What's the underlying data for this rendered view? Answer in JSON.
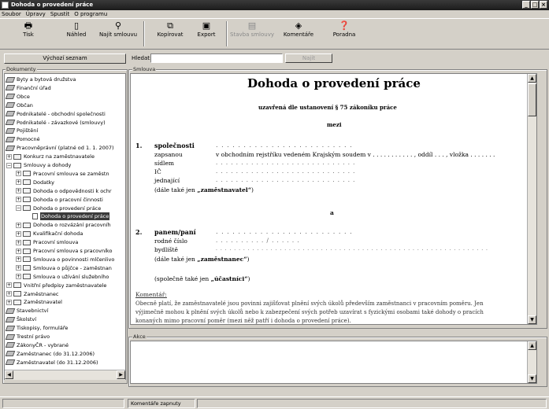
{
  "window": {
    "title": "Dohoda o provedení práce"
  },
  "menu": [
    "Soubor",
    "Úpravy",
    "Spustit",
    "O programu"
  ],
  "toolbar": [
    {
      "label": "Tisk",
      "icon": "printer-icon",
      "glyph": "🖶",
      "enabled": true
    },
    {
      "label": "Náhled",
      "icon": "page-preview-icon",
      "glyph": "▯",
      "enabled": true
    },
    {
      "label": "Najít smlouvu",
      "icon": "binoculars-icon",
      "glyph": "⚲",
      "enabled": true
    },
    {
      "label": "Kopírovat",
      "icon": "copy-icon",
      "glyph": "⧉",
      "enabled": true
    },
    {
      "label": "Export",
      "icon": "floppy-disk-icon",
      "glyph": "▣",
      "enabled": true
    },
    {
      "label": "Stavba smlouvy",
      "icon": "structure-icon",
      "glyph": "▤",
      "enabled": false
    },
    {
      "label": "Komentáře",
      "icon": "comment-icon",
      "glyph": "◈",
      "enabled": true
    },
    {
      "label": "Poradna",
      "icon": "help-icon",
      "glyph": "❓",
      "enabled": true
    }
  ],
  "left": {
    "home_button": "Výchozí seznam",
    "group_label": "Dokumenty"
  },
  "search": {
    "label": "Hledat:",
    "value": "",
    "button": "Najít"
  },
  "doc_group_label": "Smlouva",
  "akce_group_label": "Akce",
  "tree": [
    {
      "label": "Byty a bytová družstva",
      "level": 0,
      "icon": "book",
      "expander": ""
    },
    {
      "label": "Finanční úřad",
      "level": 0,
      "icon": "book",
      "expander": ""
    },
    {
      "label": "Obce",
      "level": 0,
      "icon": "book",
      "expander": ""
    },
    {
      "label": "Občan",
      "level": 0,
      "icon": "book",
      "expander": ""
    },
    {
      "label": "Podnikatelé - obchodní společnosti",
      "level": 0,
      "icon": "book",
      "expander": ""
    },
    {
      "label": "Podnikatelé - závazkové (smlouvy)",
      "level": 0,
      "icon": "book",
      "expander": ""
    },
    {
      "label": "Pojištění",
      "level": 0,
      "icon": "book",
      "expander": ""
    },
    {
      "label": "Pomocné",
      "level": 0,
      "icon": "book",
      "expander": ""
    },
    {
      "label": "Pracovněprávní (platné od 1. 1. 2007)",
      "level": 0,
      "icon": "book",
      "expander": ""
    },
    {
      "label": "Konkurz na zaměstnavatele",
      "level": 1,
      "icon": "folder",
      "expander": "+"
    },
    {
      "label": "Smlouvy a dohody",
      "level": 1,
      "icon": "folder",
      "expander": "−"
    },
    {
      "label": "Pracovní smlouva se zaměstn",
      "level": 2,
      "icon": "folder",
      "expander": "+"
    },
    {
      "label": "Dodatky",
      "level": 2,
      "icon": "folder",
      "expander": "+"
    },
    {
      "label": "Dohoda o odpovědnosti k ochr",
      "level": 2,
      "icon": "folder",
      "expander": "+"
    },
    {
      "label": "Dohoda o pracovní činnosti",
      "level": 2,
      "icon": "folder",
      "expander": "+"
    },
    {
      "label": "Dohoda o provedení práce",
      "level": 2,
      "icon": "folder",
      "expander": "−"
    },
    {
      "label": "Dohoda o provedení práce",
      "level": 3,
      "icon": "doc",
      "expander": "",
      "selected": true
    },
    {
      "label": "Dohoda o rozvázání pracovníh",
      "level": 2,
      "icon": "folder",
      "expander": "+"
    },
    {
      "label": "Kvalifikační dohoda",
      "level": 2,
      "icon": "folder",
      "expander": "+"
    },
    {
      "label": "Pracovní smlouva",
      "level": 2,
      "icon": "folder",
      "expander": "+"
    },
    {
      "label": "Pracovní smlouva s pracovníko",
      "level": 2,
      "icon": "folder",
      "expander": "+"
    },
    {
      "label": "Smlouva o povinnosti mlčenlivo",
      "level": 2,
      "icon": "folder",
      "expander": "+"
    },
    {
      "label": "Smlouva o půjčce - zaměstnan",
      "level": 2,
      "icon": "folder",
      "expander": "+"
    },
    {
      "label": "Smlouva o užívání služebního",
      "level": 2,
      "icon": "folder",
      "expander": "+"
    },
    {
      "label": "Vnitřní předpisy zaměstnavatele",
      "level": 1,
      "icon": "folder",
      "expander": "+"
    },
    {
      "label": "Zaměstnanec",
      "level": 1,
      "icon": "folder",
      "expander": "+"
    },
    {
      "label": "Zaměstnavatel",
      "level": 1,
      "icon": "folder",
      "expander": "+"
    },
    {
      "label": "Stavebnictví",
      "level": 0,
      "icon": "book",
      "expander": ""
    },
    {
      "label": "Školství",
      "level": 0,
      "icon": "book",
      "expander": ""
    },
    {
      "label": "Tiskopisy, formuláře",
      "level": 0,
      "icon": "book",
      "expander": ""
    },
    {
      "label": "Trestní právo",
      "level": 0,
      "icon": "book",
      "expander": ""
    },
    {
      "label": "ZákonyČR - vybrané",
      "level": 0,
      "icon": "book",
      "expander": ""
    },
    {
      "label": "Zaměstnanec (do 31.12.2006)",
      "level": 0,
      "icon": "book",
      "expander": ""
    },
    {
      "label": "Zaměstnavatel (do 31.12.2006)",
      "level": 0,
      "icon": "book",
      "expander": ""
    }
  ],
  "document": {
    "title": "Dohoda o provedení práce",
    "subtitle": "uzavřená dle ustanovení § 75 zákoníku práce",
    "between": "mezi",
    "p1_num": "1.",
    "p1_name": "společnosti",
    "p1_rows": [
      {
        "k": "zapsanou",
        "v": "v obchodním rejstříku vedeném Krajským soudem v . . . . . . . . . . . , oddíl . . . , vložka . . . . . . ."
      },
      {
        "k": "sídlem",
        "v": ". . . . . . . . . . . . . . . . . . . . . . . . . . . ."
      },
      {
        "k": "IČ",
        "v": ". . . . . . . . . . . . . . . . . . . . . . . . . . . ."
      },
      {
        "k": "jednající",
        "v": ". . . . . . . . . . . . . . . . . . . . . . . . . . . ."
      }
    ],
    "p1_dots": ". . . . . . . . . . . . . . . . . . . . . . . . .",
    "p1_alias_prefix": "(dále také jen ",
    "p1_alias_term": "„zaměstnavatel“",
    "p1_alias_suffix": ")",
    "and": "a",
    "p2_num": "2.",
    "p2_name": "panem/paní",
    "p2_dots": ". . . . . . . . . . . . . . . . . . . . . . . . .",
    "p2_rows": [
      {
        "k": "rodné číslo",
        "v": ". . . . . . . . . . / . . . . . ."
      },
      {
        "k": "bydliště",
        "v": ". . . . . . . . . . . . . . . . . . . . . . . . . . . . . . . . . . . . . . . . . . . . . . . . . . . . . . . . . . . ."
      }
    ],
    "p2_alias_prefix": "(dále také jen ",
    "p2_alias_term": "„zaměstnanec“",
    "p2_alias_suffix": ")",
    "both_prefix": "(společně také jen ",
    "both_term": "„účastníci“",
    "both_suffix": ")",
    "comment_heading": "Komentář:",
    "comment_lines": [
      "Obecně platí, že zaměstnavatelé jsou povinni zajišťovat plnění svých úkolů především zaměstnanci v pracovním poměru. Jen",
      "výjimečně mohou k plnění svých úkolů nebo k zabezpečení svých potřeb uzavírat s fyzickými osobami také dohody o pracích",
      "konaných mimo pracovní poměr (mezi něž patří i dohoda o provedení práce)."
    ]
  },
  "status": {
    "panel2": "Komentáře zapnuty"
  }
}
